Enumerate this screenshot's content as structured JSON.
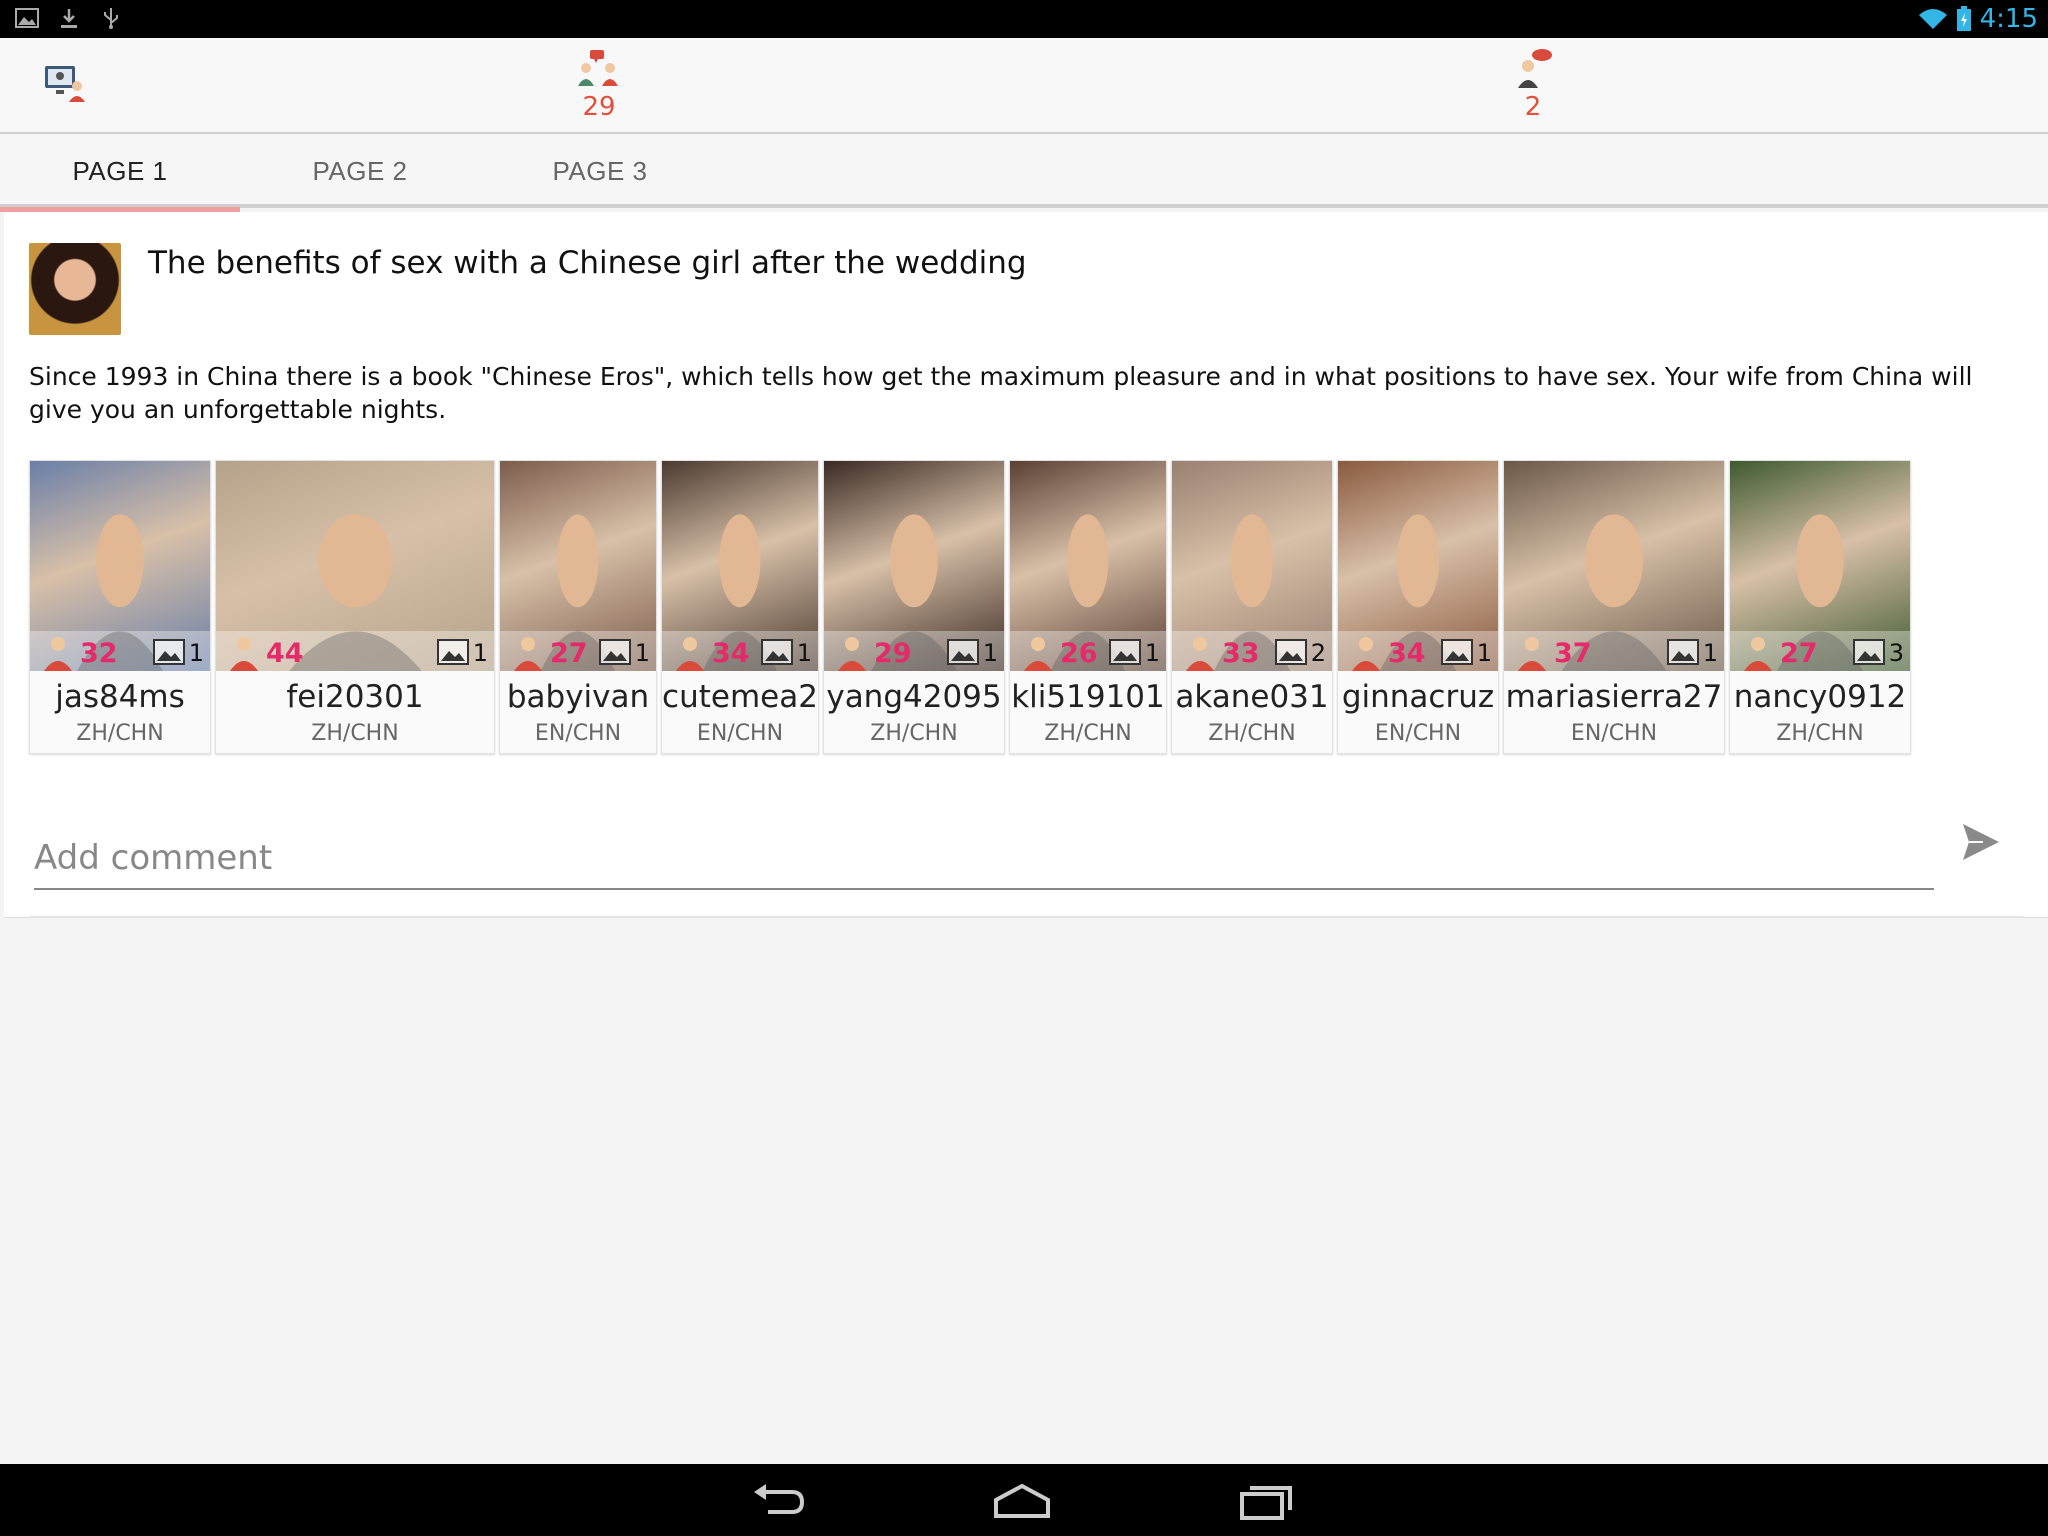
{
  "status_bar": {
    "time": "4:15",
    "left_icons": [
      "picture-icon",
      "download-icon",
      "usb-icon"
    ],
    "right_icons": [
      "wifi-icon",
      "battery-icon"
    ]
  },
  "action_bar": {
    "items": [
      {
        "icon": "video-chat-icon",
        "count": ""
      },
      {
        "icon": "chat-users-icon",
        "count": "29"
      },
      {
        "icon": "message-user-icon",
        "count": "2"
      }
    ]
  },
  "tabs": [
    {
      "label": "PAGE 1",
      "active": true
    },
    {
      "label": "PAGE 2",
      "active": false
    },
    {
      "label": "PAGE 3",
      "active": false
    }
  ],
  "post": {
    "title": "The benefits of sex with a Chinese girl after the wedding",
    "body": "Since 1993 in China there is a book \"Chinese Eros\", which tells how get the maximum pleasure and in what positions to have sex. Your wife from China will give you an unforgettable nights."
  },
  "profiles": [
    {
      "username": "jas84ms",
      "age": "32",
      "photos": "1",
      "lang": "ZH/CHN",
      "color": "#6a7fa8"
    },
    {
      "username": "fei20301",
      "age": "44",
      "photos": "1",
      "lang": "ZH/CHN",
      "color": "#b5a28a"
    },
    {
      "username": "babyivan",
      "age": "27",
      "photos": "1",
      "lang": "EN/CHN",
      "color": "#7b5c4c"
    },
    {
      "username": "cutemea2",
      "age": "34",
      "photos": "1",
      "lang": "EN/CHN",
      "color": "#4a3a30"
    },
    {
      "username": "yang42095",
      "age": "29",
      "photos": "1",
      "lang": "ZH/CHN",
      "color": "#3a2a24"
    },
    {
      "username": "kli519101",
      "age": "26",
      "photos": "1",
      "lang": "ZH/CHN",
      "color": "#5a4034"
    },
    {
      "username": "akane031",
      "age": "33",
      "photos": "2",
      "lang": "ZH/CHN",
      "color": "#9a8070"
    },
    {
      "username": "ginnacruz",
      "age": "34",
      "photos": "1",
      "lang": "EN/CHN",
      "color": "#8a5a40"
    },
    {
      "username": "mariasierra27",
      "age": "37",
      "photos": "1",
      "lang": "EN/CHN",
      "color": "#6a5848"
    },
    {
      "username": "nancy0912",
      "age": "27",
      "photos": "3",
      "lang": "ZH/CHN",
      "color": "#3e5a30"
    }
  ],
  "comment": {
    "placeholder": "Add comment"
  },
  "nav_bar": {
    "buttons": [
      "back-icon",
      "home-icon",
      "recent-apps-icon"
    ]
  }
}
